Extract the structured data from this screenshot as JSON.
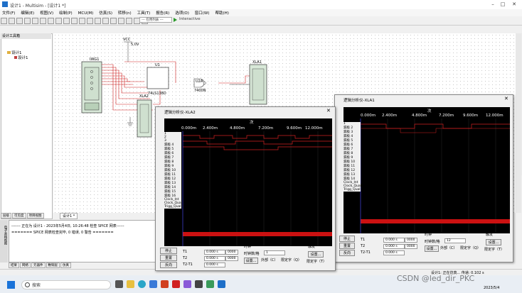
{
  "window": {
    "title": "设计1 - Multisim - [设计1 *]"
  },
  "menu": [
    "文件(F)",
    "编辑(E)",
    "视图(V)",
    "绘制(P)",
    "MCU(M)",
    "仿真(S)",
    "转移(n)",
    "工具(T)",
    "报告(R)",
    "选项(O)",
    "窗口(W)",
    "帮助(H)"
  ],
  "toolbar": {
    "sim_combo": "--- 在用列表 ---",
    "interactive": "Interactive"
  },
  "design_panel": {
    "title": "设计工具箱",
    "tree_root": "设计1",
    "tree_child": "设计1",
    "tabs": [
      "层级",
      "可见度",
      "项目视图"
    ]
  },
  "schematic": {
    "vcc": "VCC",
    "vcc_value": "5.0V",
    "word_gen": "IWG1",
    "ic_ref": "U1",
    "ic_part": "74LS138D",
    "gate_ref": "U2A",
    "gate_part": "7400N",
    "la_ref": "XLA2",
    "la_ref2": "XLA1",
    "doc_tab": "设计1 *"
  },
  "output": {
    "line1": "------- 正在为 设计1 - 2023年5月4日, 10:26:48 检查 SPICE 网表------",
    "line2": "======= SPICE 网表检查完毕, 0 错误, 0 警告 ======="
  },
  "bottom_tabs": [
    "结果",
    "网络",
    "元器件",
    "敷铜层",
    "仿真"
  ],
  "side_label": "电子表格视图",
  "statusbar": {
    "text": "设计1: 正在仿真... 传递: 0.102 s"
  },
  "taskbar": {
    "search_placeholder": "搜索",
    "date": "2023/5/4"
  },
  "watermark": "CSDN @led_dir_PKC",
  "la2": {
    "title": "逻辑分析仪-XLA2",
    "header_char": "次",
    "ticks": [
      "0.000m",
      "2.400m",
      "4.800m",
      "7.200m",
      "9.600m",
      "12.000m"
    ],
    "channels": [
      "1",
      "2",
      "3",
      "漏极 4",
      "漏极 5",
      "漏极 6",
      "漏极 7",
      "漏极 8",
      "漏极 9",
      "漏极 10",
      "漏极 11",
      "漏极 12",
      "漏极 13",
      "漏极 14",
      "漏极 15",
      "漏极 16",
      "Clock_Int",
      "Clock_Qual",
      "Trigg_Qual"
    ],
    "buttons": {
      "stop": "停止",
      "reset": "重置",
      "reverse": "反向"
    },
    "t1": "T1",
    "t2": "T2",
    "t2t1": "T2-T1",
    "t1_val": "0.000 s",
    "t1_val2": "0000",
    "t2_val": "0.000 s",
    "t2_val2": "0000",
    "t2t1_val": "0.000 s",
    "clock_title": "时钟",
    "clock_per_div_label": "时钟数/格",
    "clock_per_div": "1",
    "settings": "设置...",
    "external": "外部（C）",
    "qualifier": "限定字（Q）",
    "trigger_title": "触发",
    "trigger_settings": "设置...",
    "trigger_qualifier": "限定字（T）"
  },
  "la1": {
    "title": "逻辑分析仪-XLA1",
    "header_char": "次",
    "ticks": [
      "0.000m",
      "2.400m",
      "4.800m",
      "7.200m",
      "9.600m",
      "12.000m"
    ],
    "channels": [
      "1",
      "漏极 2",
      "漏极 3",
      "漏极 4",
      "漏极 5",
      "漏极 6",
      "漏极 7",
      "漏极 8",
      "漏极 9",
      "漏极 10",
      "漏极 11",
      "漏极 12",
      "漏极 13",
      "漏极 14",
      "Clock_Int",
      "Clock_Qual",
      "Trigg_Qual"
    ],
    "buttons": {
      "stop": "停止",
      "reset": "重置",
      "reverse": "反向"
    },
    "t1": "T1",
    "t2": "T2",
    "t2t1": "T2-T1",
    "t1_val": "0.000 s",
    "t1_val2": "0000",
    "t2_val": "0.000 s",
    "t2_val2": "0000",
    "t2t1_val": "0.000 s",
    "clock_title": "时钟",
    "clock_per_div_label": "时钟数/格",
    "clock_per_div": "12",
    "settings": "设置...",
    "external": "外部（C）",
    "qualifier": "限定字（Q）",
    "trigger_title": "触发",
    "trigger_settings": "设置...",
    "trigger_qualifier": "限定字（T）"
  },
  "colors": {
    "plot_bg": "#000000",
    "trace": "#d02020",
    "clock": "#cc1111",
    "cursor": "#4444ff"
  }
}
